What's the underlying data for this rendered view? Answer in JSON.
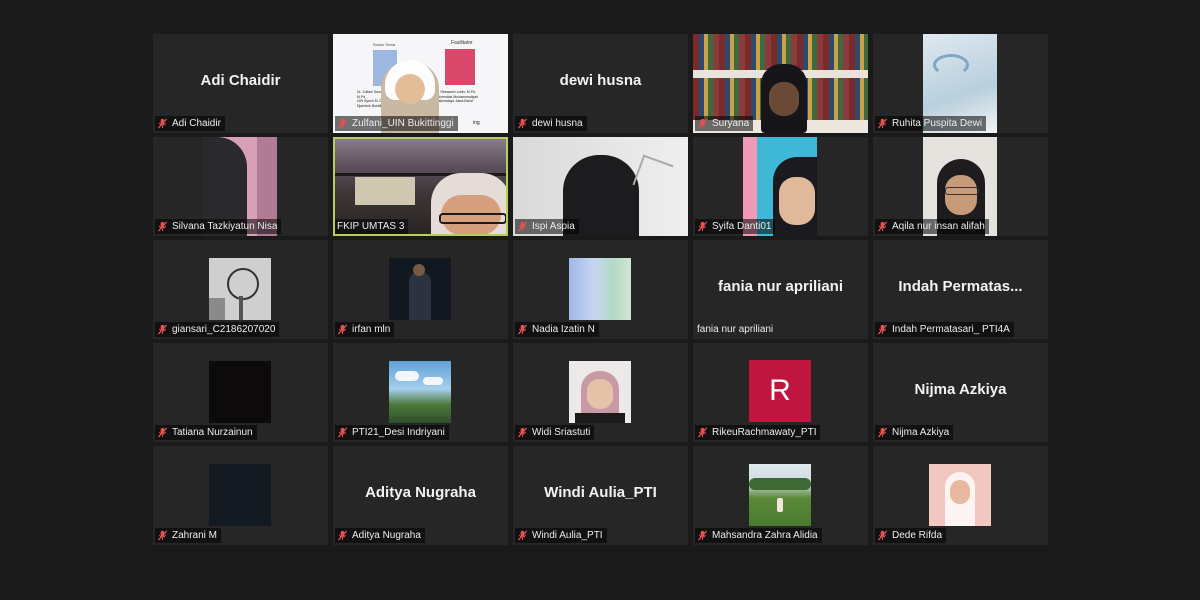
{
  "meeting": {
    "participants": [
      {
        "name": "Adi Chaidir",
        "tile_text": "Adi Chaidir",
        "video": false,
        "muted": true
      },
      {
        "name": "Zulfani_UIN Bukittinggi",
        "video": true,
        "muted": true,
        "slide": {
          "left_title": "Susun Tema",
          "left_name": "Dr. Zulfani Sesmiarni, M.Pd",
          "left_inst": "UIN Syech M. Djamil Djambek Bukittinggi",
          "right_title": "Fasilitator",
          "right_name": "Dr. Reeaarch Lubis, M.Pd.",
          "right_inst": "Universitas Muhammadiyah Tasikmalaya Jawa Barat",
          "bottom": "ing"
        }
      },
      {
        "name": "dewi husna",
        "tile_text": "dewi husna",
        "video": false,
        "muted": true
      },
      {
        "name": "Suryana",
        "video": true,
        "muted": true
      },
      {
        "name": "Ruhita Puspita Dewi",
        "video": true,
        "muted": true
      },
      {
        "name": "Silvana Tazkiyatun Nisa",
        "video": true,
        "muted": true
      },
      {
        "name": "FKIP UMTAS 3",
        "video": true,
        "muted": false,
        "active": true
      },
      {
        "name": "Ispi Aspia",
        "video": true,
        "muted": true
      },
      {
        "name": "Syifa Danti01",
        "video": true,
        "muted": true
      },
      {
        "name": "Aqila nur insan alifah",
        "video": true,
        "muted": true
      },
      {
        "name": "giansari_C2186207020",
        "video": true,
        "muted": true
      },
      {
        "name": "irfan mln",
        "video": true,
        "muted": true
      },
      {
        "name": "Nadia Izatin N",
        "video": true,
        "muted": true
      },
      {
        "name": "fania nur apriliani",
        "tile_text": "fania nur apriliani",
        "video": false,
        "muted": false
      },
      {
        "name": "Indah Permatasari_ PTI4A",
        "tile_text": "Indah  Permatas...",
        "video": false,
        "muted": true
      },
      {
        "name": "Tatiana Nurzainun",
        "video": true,
        "muted": true
      },
      {
        "name": "PTI21_Desi Indriyani",
        "video": true,
        "muted": true
      },
      {
        "name": "Widi Sriastuti",
        "video": true,
        "muted": true
      },
      {
        "name": "RikeuRachmawaty_PTI",
        "avatar_letter": "R",
        "video": false,
        "muted": true
      },
      {
        "name": "Nijma Azkiya",
        "tile_text": "Nijma Azkiya",
        "video": false,
        "muted": true
      },
      {
        "name": "Zahrani M",
        "video": true,
        "muted": true
      },
      {
        "name": "Aditya Nugraha",
        "tile_text": "Aditya Nugraha",
        "video": false,
        "muted": true
      },
      {
        "name": "Windi Aulia_PTI",
        "tile_text": "Windi Aulia_PTI",
        "video": false,
        "muted": true
      },
      {
        "name": "Mahsandra Zahra Alidia",
        "video": true,
        "muted": true
      },
      {
        "name": "Dede Rifda",
        "video": true,
        "muted": true
      }
    ]
  },
  "colors": {
    "background": "#1a1a1a",
    "tile": "#262626",
    "active_border": "#b5cf5a",
    "muted_icon": "#e8514f",
    "avatar_brand": "#c0153f"
  },
  "icons": {
    "muted": "microphone-muted-icon"
  }
}
